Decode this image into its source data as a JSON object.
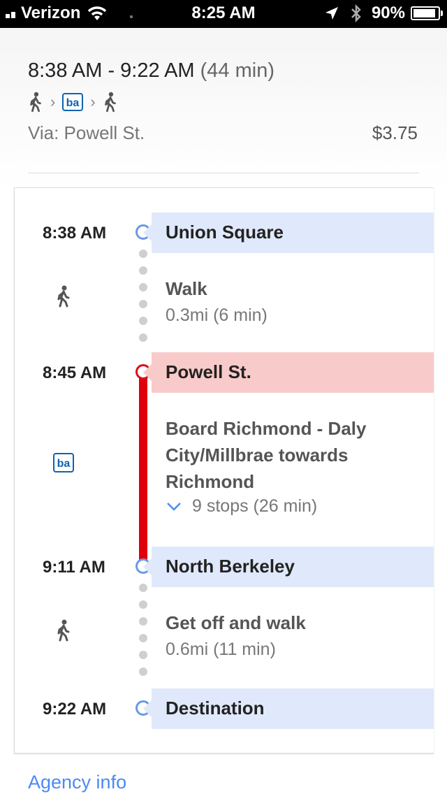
{
  "status_bar": {
    "carrier": "Verizon",
    "time": "8:25 AM",
    "battery": "90%",
    "battery_level": 0.9
  },
  "summary": {
    "time_range": "8:38 AM - 9:22 AM",
    "duration": "(44 min)",
    "modes": [
      "walk-icon",
      "bart-icon",
      "walk-icon"
    ],
    "via": "Via: Powell St.",
    "price": "$3.75"
  },
  "timeline": {
    "stops": [
      {
        "time": "8:38 AM",
        "name": "Union Square"
      },
      {
        "time": "8:45 AM",
        "name": "Powell St."
      },
      {
        "time": "9:11 AM",
        "name": "North Berkeley"
      },
      {
        "time": "9:22 AM",
        "name": "Destination"
      }
    ],
    "steps": [
      {
        "title": "Walk",
        "detail": "0.3mi (6 min)"
      },
      {
        "title_lines": [
          "Board Richmond - Daly",
          "City/Millbrae towards",
          "Richmond"
        ],
        "detail": "9 stops (26 min)"
      },
      {
        "title": "Get off and walk",
        "detail": "0.6mi (11 min)"
      }
    ]
  },
  "footer": {
    "agency_link": "Agency info"
  },
  "colors": {
    "accent_blue": "#4a8af4",
    "stop_blue": "#e0e9fb",
    "stop_red": "#f9caca",
    "line_red": "#e0000c"
  }
}
